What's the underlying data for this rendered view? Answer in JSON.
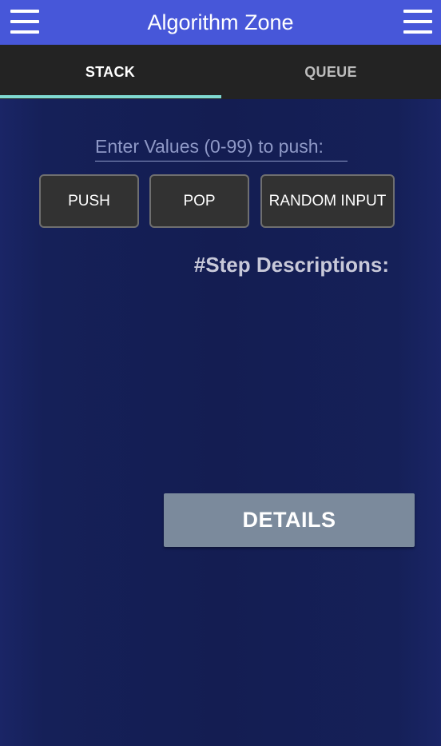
{
  "app_bar": {
    "title": "Algorithm Zone",
    "left_icon": "menu-icon",
    "right_icon": "menu-icon",
    "background_color": "#4757d9"
  },
  "tabs": [
    {
      "label": "STACK",
      "selected": true
    },
    {
      "label": "QUEUE",
      "selected": false
    }
  ],
  "tab_indicator_color": "#7fd9d2",
  "input": {
    "placeholder": "Enter Values (0-99) to push:",
    "value": ""
  },
  "buttons": {
    "push": "PUSH",
    "pop": "POP",
    "random": "RANDOM INPUT"
  },
  "steps_heading": "#Step Descriptions:",
  "details_button": "DETAILS"
}
